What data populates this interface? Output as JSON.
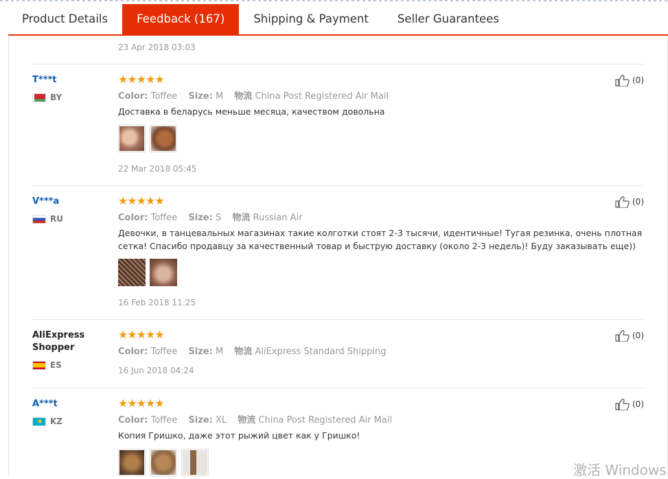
{
  "tabs": [
    {
      "label": "Product Details"
    },
    {
      "label": "Feedback (167)"
    },
    {
      "label": "Shipping & Payment"
    },
    {
      "label": "Seller Guarantees"
    }
  ],
  "prev_date": "23 Apr 2018 03:03",
  "labels": {
    "color": "Color:",
    "size": "Size:",
    "ship": "物流"
  },
  "reviews": [
    {
      "user": "T***t",
      "country": "BY",
      "stars": "★★★★★",
      "color": "Toffee",
      "size": "M",
      "shipping": "China Post Registered Air Mail",
      "text": "Доставка в беларусь меньше месяца, качеством довольна",
      "date": "22 Mar 2018 05:45",
      "likes": "(0)"
    },
    {
      "user": "V***a",
      "country": "RU",
      "stars": "★★★★★",
      "color": "Toffee",
      "size": "S",
      "shipping": "Russian Air",
      "text": "Девочки, в танцевальных магазинах такие колготки стоят 2-3 тысячи, идентичные! Тугая резинка, очень плотная сетка! Спасибо продавцу за качественный товар и быструю доставку (около 2-3 недель)! Буду заказывать еще))",
      "date": "16 Feb 2018 11:25",
      "likes": "(0)"
    },
    {
      "user": "AliExpress Shopper",
      "country": "ES",
      "stars": "★★★★★",
      "color": "Toffee",
      "size": "M",
      "shipping": "AliExpress Standard Shipping",
      "date": "16 Jun 2018 04:24",
      "likes": "(0)"
    },
    {
      "user": "A***t",
      "country": "KZ",
      "stars": "★★★★★",
      "color": "Toffee",
      "size": "XL",
      "shipping": "China Post Registered Air Mail",
      "text": "Копия Гришко, даже этот рыжий цвет как у Гришко!",
      "likes": "(0)"
    }
  ],
  "watermark": "激活 Windows"
}
